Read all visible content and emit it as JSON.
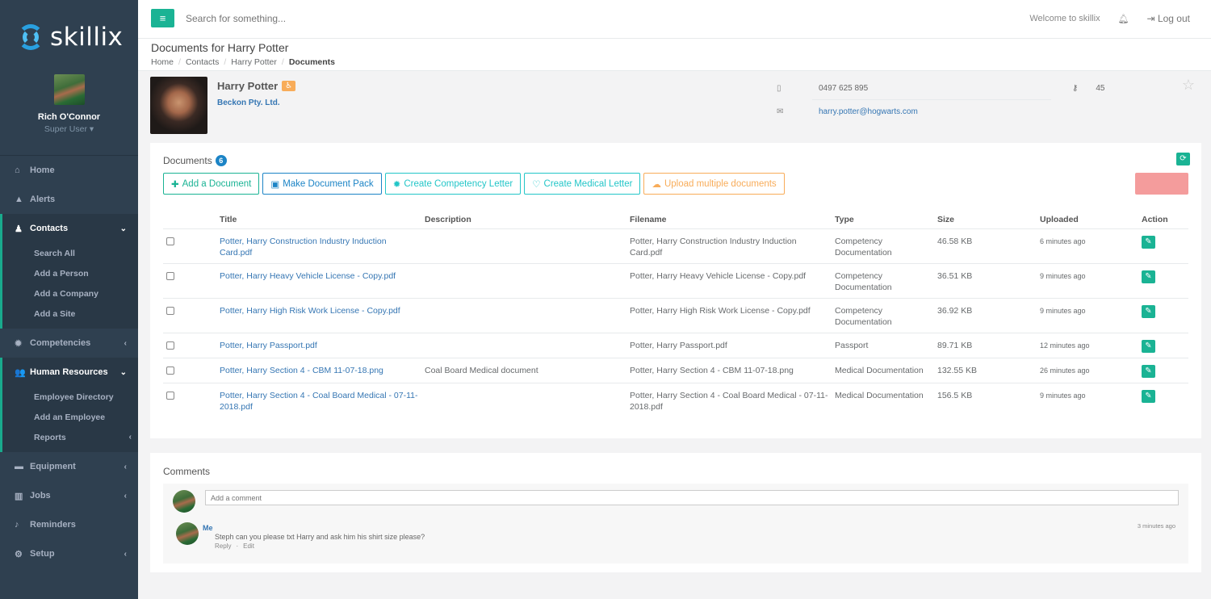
{
  "brand": {
    "name": "skillix"
  },
  "user": {
    "name": "Rich O'Connor",
    "role": "Super User"
  },
  "nav": {
    "home": "Home",
    "alerts": "Alerts",
    "contacts": "Contacts",
    "contacts_sub": [
      "Search All",
      "Add a Person",
      "Add a Company",
      "Add a Site"
    ],
    "competencies": "Competencies",
    "hr": "Human Resources",
    "hr_sub": [
      "Employee Directory",
      "Add an Employee",
      "Reports"
    ],
    "equipment": "Equipment",
    "jobs": "Jobs",
    "reminders": "Reminders",
    "setup": "Setup"
  },
  "topbar": {
    "search_placeholder": "Search for something...",
    "welcome": "Welcome to skillix",
    "logout": "Log out"
  },
  "page": {
    "title": "Documents for Harry Potter",
    "breadcrumbs": [
      "Home",
      "Contacts",
      "Harry Potter",
      "Documents"
    ]
  },
  "contact": {
    "name": "Harry Potter",
    "company": "Beckon Pty. Ltd.",
    "phone": "0497 625 895",
    "email": "harry.potter@hogwarts.com",
    "key_value": "45"
  },
  "documents": {
    "title": "Documents",
    "count": "6",
    "buttons": {
      "add": "Add a Document",
      "pack": "Make Document Pack",
      "competency": "Create Competency Letter",
      "medical": "Create Medical Letter",
      "upload": "Upload multiple documents"
    },
    "columns": [
      "Title",
      "Description",
      "Filename",
      "Type",
      "Size",
      "Uploaded",
      "Action"
    ],
    "rows": [
      {
        "title": "Potter, Harry Construction Industry Induction Card.pdf",
        "description": "",
        "filename": "Potter, Harry Construction Industry Induction Card.pdf",
        "type": "Competency Documentation",
        "size": "46.58 KB",
        "uploaded": "6 minutes ago"
      },
      {
        "title": "Potter, Harry Heavy Vehicle License - Copy.pdf",
        "description": "",
        "filename": "Potter, Harry Heavy Vehicle License - Copy.pdf",
        "type": "Competency Documentation",
        "size": "36.51 KB",
        "uploaded": "9 minutes ago"
      },
      {
        "title": "Potter, Harry High Risk Work License - Copy.pdf",
        "description": "",
        "filename": "Potter, Harry High Risk Work License - Copy.pdf",
        "type": "Competency Documentation",
        "size": "36.92 KB",
        "uploaded": "9 minutes ago"
      },
      {
        "title": "Potter, Harry Passport.pdf",
        "description": "",
        "filename": "Potter, Harry Passport.pdf",
        "type": "Passport",
        "size": "89.71 KB",
        "uploaded": "12 minutes ago"
      },
      {
        "title": "Potter, Harry Section 4 - CBM 11-07-18.png",
        "description": "Coal Board Medical document",
        "filename": "Potter, Harry Section 4 - CBM 11-07-18.png",
        "type": "Medical Documentation",
        "size": "132.55 KB",
        "uploaded": "26 minutes ago"
      },
      {
        "title": "Potter, Harry Section 4 - Coal Board Medical - 07-11-2018.pdf",
        "description": "",
        "filename": "Potter, Harry Section 4 - Coal Board Medical - 07-11-2018.pdf",
        "type": "Medical Documentation",
        "size": "156.5 KB",
        "uploaded": "9 minutes ago"
      }
    ]
  },
  "comments": {
    "title": "Comments",
    "placeholder": "Add a comment",
    "items": [
      {
        "author": "Me",
        "text": "Steph can you please txt Harry and ask him his shirt size please?",
        "time": "3 minutes ago",
        "reply": "Reply",
        "edit": "Edit"
      }
    ]
  },
  "colors": {
    "sidebar": "#2f4050",
    "primary": "#1ab394",
    "link": "#3576b3",
    "info": "#1c84c6",
    "warning": "#f8ac59",
    "danger": "#f28b8b"
  }
}
